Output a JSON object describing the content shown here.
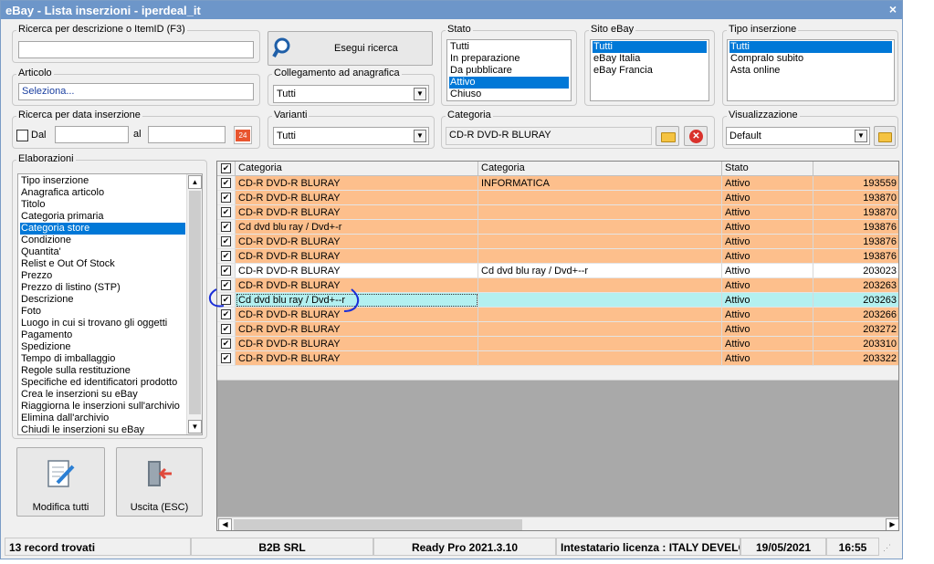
{
  "window": {
    "title": "eBay - Lista inserzioni - iperdeal_it",
    "close": "×"
  },
  "search_desc": {
    "label": "Ricerca per descrizione o ItemID (F3)",
    "value": ""
  },
  "search_button": "Esegui ricerca",
  "articolo": {
    "label": "Articolo",
    "value": "Seleziona..."
  },
  "collegamento": {
    "label": "Collegamento ad anagrafica",
    "value": "Tutti"
  },
  "data_ins": {
    "label": "Ricerca per data inserzione",
    "dal": "Dal",
    "al": "al"
  },
  "varianti": {
    "label": "Varianti",
    "value": "Tutti"
  },
  "stato": {
    "label": "Stato",
    "items": [
      "Tutti",
      "In preparazione",
      "Da pubblicare",
      "Attivo",
      "Chiuso"
    ],
    "selected": 3
  },
  "sito": {
    "label": "Sito eBay",
    "items": [
      "Tutti",
      "eBay Italia",
      "eBay Francia"
    ],
    "selected": 0
  },
  "tipo": {
    "label": "Tipo inserzione",
    "items": [
      "Tutti",
      "Compralo subito",
      "Asta online"
    ],
    "selected": 0
  },
  "categoria": {
    "label": "Categoria",
    "value": "CD-R DVD-R BLURAY"
  },
  "visualizzazione": {
    "label": "Visualizzazione",
    "value": "Default"
  },
  "elaborazioni": {
    "label": "Elaborazioni",
    "selected": 4,
    "items": [
      "Tipo inserzione",
      "Anagrafica articolo",
      "Titolo",
      "Categoria primaria",
      "Categoria store",
      "Condizione",
      "Quantita'",
      "Relist e Out Of Stock",
      "Prezzo",
      "Prezzo di listino (STP)",
      "Descrizione",
      "Foto",
      "Luogo in cui si trovano gli oggetti",
      "Pagamento",
      "Spedizione",
      "Tempo di imballaggio",
      "Regole sulla restituzione",
      "Specifiche ed identificatori prodotto",
      "Crea le inserzioni su eBay",
      "Riaggiorna le inserzioni sull'archivio",
      "Elimina dall'archivio",
      "Chiudi le inserzioni su eBay"
    ]
  },
  "modifica_button": "Modifica tutti",
  "uscita_button": "Uscita (ESC)",
  "calendar_icon_text": "24",
  "grid": {
    "headers": [
      "Categoria",
      "Categoria",
      "Stato",
      ""
    ],
    "rows": [
      {
        "c1": "CD-R DVD-R BLURAY",
        "c2": "INFORMATICA",
        "c3": "Attivo",
        "c4": "193559",
        "style": "orange"
      },
      {
        "c1": "CD-R DVD-R BLURAY",
        "c2": "",
        "c3": "Attivo",
        "c4": "193870",
        "style": "orange"
      },
      {
        "c1": "CD-R DVD-R BLURAY",
        "c2": "",
        "c3": "Attivo",
        "c4": "193870",
        "style": "orange"
      },
      {
        "c1": "Cd dvd blu ray / Dvd+-r",
        "c2": "",
        "c3": "Attivo",
        "c4": "193876",
        "style": "orange"
      },
      {
        "c1": "CD-R DVD-R BLURAY",
        "c2": "",
        "c3": "Attivo",
        "c4": "193876",
        "style": "orange"
      },
      {
        "c1": "CD-R DVD-R BLURAY",
        "c2": "",
        "c3": "Attivo",
        "c4": "193876",
        "style": "orange"
      },
      {
        "c1": "CD-R DVD-R BLURAY",
        "c2": "Cd dvd blu ray / Dvd+--r",
        "c3": "Attivo",
        "c4": "203023",
        "style": "white"
      },
      {
        "c1": "CD-R DVD-R BLURAY",
        "c2": "",
        "c3": "Attivo",
        "c4": "203263",
        "style": "orange"
      },
      {
        "c1": "Cd dvd blu ray / Dvd+--r",
        "c2": "",
        "c3": "Attivo",
        "c4": "203263",
        "style": "cyan"
      },
      {
        "c1": "CD-R DVD-R BLURAY",
        "c2": "",
        "c3": "Attivo",
        "c4": "203266",
        "style": "orange"
      },
      {
        "c1": "CD-R DVD-R BLURAY",
        "c2": "",
        "c3": "Attivo",
        "c4": "203272",
        "style": "orange"
      },
      {
        "c1": "CD-R DVD-R BLURAY",
        "c2": "",
        "c3": "Attivo",
        "c4": "203310",
        "style": "orange"
      },
      {
        "c1": "CD-R DVD-R BLURAY",
        "c2": "",
        "c3": "Attivo",
        "c4": "203322",
        "style": "orange"
      }
    ]
  },
  "statusbar": {
    "records": "13 record trovati",
    "company": "B2B SRL",
    "version": "Ready Pro 2021.3.10",
    "license": "Intestatario licenza : ITALY DEVELO",
    "date": "19/05/2021",
    "time": "16:55"
  },
  "colors": {
    "orange": "#fdbf8c",
    "cyan": "#b3f0f0",
    "white": "#ffffff",
    "title": "#6d96c9",
    "selection": "#0078d7"
  }
}
